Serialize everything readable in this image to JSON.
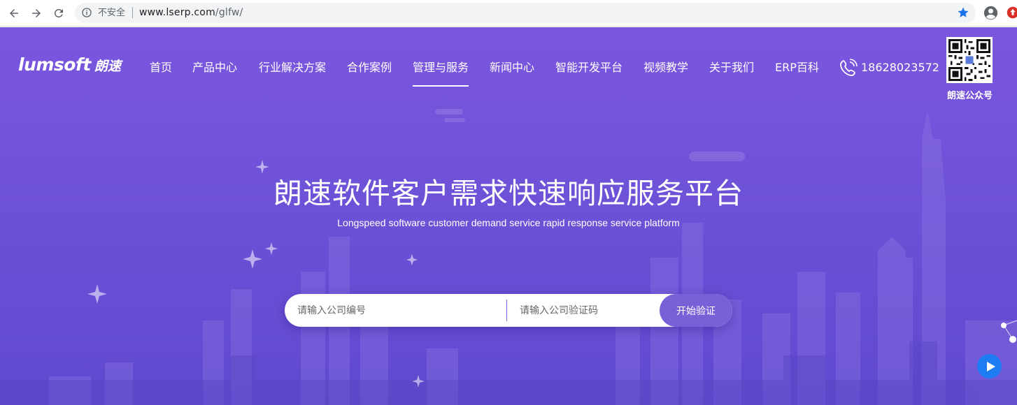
{
  "browser": {
    "security_label": "不安全",
    "url_host": "www.lserp.com",
    "url_path": "/glfw/"
  },
  "site": {
    "logo_en": "lumsoft",
    "logo_cn": "朗速",
    "nav": [
      {
        "label": "首页"
      },
      {
        "label": "产品中心"
      },
      {
        "label": "行业解决方案"
      },
      {
        "label": "合作案例"
      },
      {
        "label": "管理与服务",
        "active": true
      },
      {
        "label": "新闻中心"
      },
      {
        "label": "智能开发平台"
      },
      {
        "label": "视频教学"
      },
      {
        "label": "关于我们"
      },
      {
        "label": "ERP百科"
      }
    ],
    "phone": "18628023572",
    "qr_label": "朗速公众号"
  },
  "hero": {
    "title": "朗速软件客户需求快速响应服务平台",
    "subtitle": "Longspeed software customer demand service rapid response service platform"
  },
  "verify_form": {
    "company_no_placeholder": "请输入公司编号",
    "company_code_placeholder": "请输入公司验证码",
    "submit_label": "开始验证"
  },
  "colors": {
    "hero_top": "#7a56dd",
    "hero_bottom": "#6049cf",
    "button": "#7a60d6",
    "play": "#1e7cf2",
    "star": "#1a73e8"
  },
  "icons": {
    "back": "arrow-left-icon",
    "forward": "arrow-right-icon",
    "reload": "reload-icon",
    "info": "info-icon",
    "bookmark": "star-icon",
    "profile": "account-icon",
    "extension": "extension-icon",
    "phone": "phone-icon",
    "play": "play-icon"
  }
}
